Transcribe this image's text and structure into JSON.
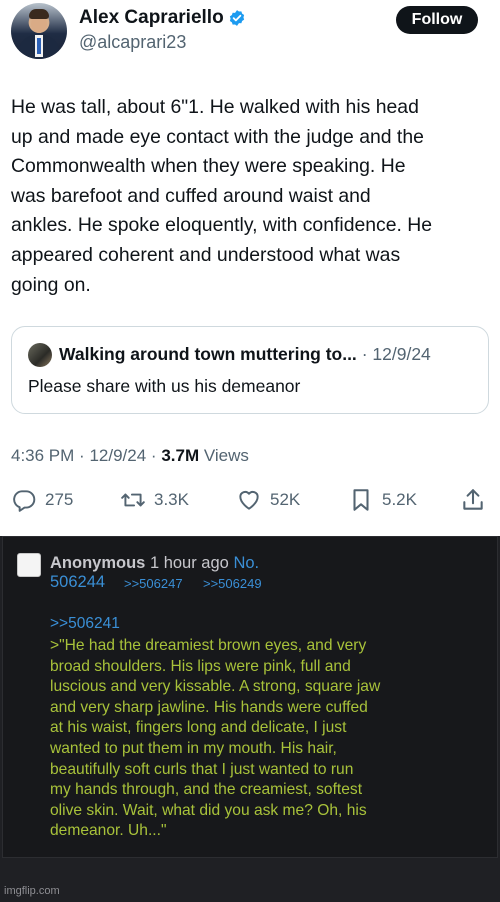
{
  "tweet": {
    "display_name": "Alex Caprariello",
    "handle": "@alcaprari23",
    "follow_label": "Follow",
    "text_lines": [
      "He was tall, about 6\"1. He walked with his head",
      "up and made eye contact with the judge and the",
      "Commonwealth when they were speaking. He",
      "was barefoot and cuffed around waist and",
      "ankles. He spoke eloquently, with confidence. He",
      "appeared coherent and understood what was",
      "going on."
    ],
    "quote": {
      "author": "Walking around town muttering to...",
      "separator": "·",
      "date": "12/9/24",
      "text": "Please share with us his demeanor"
    },
    "meta": {
      "time": "4:36 PM",
      "separator": "·",
      "date": "12/9/24",
      "separator2": "·",
      "views_count": "3.7M",
      "views_label": "Views"
    },
    "actions": {
      "replies": "275",
      "reposts": "3.3K",
      "likes": "52K",
      "bookmarks": "5.2K"
    },
    "icons": {
      "verified": "verified-badge-icon",
      "reply": "reply-icon",
      "repost": "repost-icon",
      "like": "heart-icon",
      "bookmark": "bookmark-icon",
      "share": "share-icon"
    },
    "colors": {
      "verified": "#1d9bf0",
      "muted": "#536471",
      "text": "#0f1419"
    }
  },
  "forum_post": {
    "name": "Anonymous",
    "posted": "1 hour ago",
    "no_label": "No.",
    "post_number": "506244",
    "backlinks": [
      ">>506247",
      ">>506249"
    ],
    "reply_ref": ">>506241",
    "greentext_lines": [
      ">\"He had the dreamiest brown eyes, and very",
      "broad shoulders. His lips were pink, full and",
      "luscious and very kissable. A strong, square jaw",
      "and very sharp jawline. His hands were cuffed",
      "at his waist, fingers long and delicate, I just",
      "wanted to put them in my mouth. His hair,",
      "beautifully soft curls that I just wanted to run",
      "my hands through, and the creamiest, softest",
      "olive skin. Wait, what did you ask me? Oh, his",
      "demeanor. Uh...\""
    ],
    "colors": {
      "background": "#17181b",
      "link": "#3a8fd6",
      "greentext": "#a8c23a"
    }
  },
  "watermark": "imgflip.com"
}
